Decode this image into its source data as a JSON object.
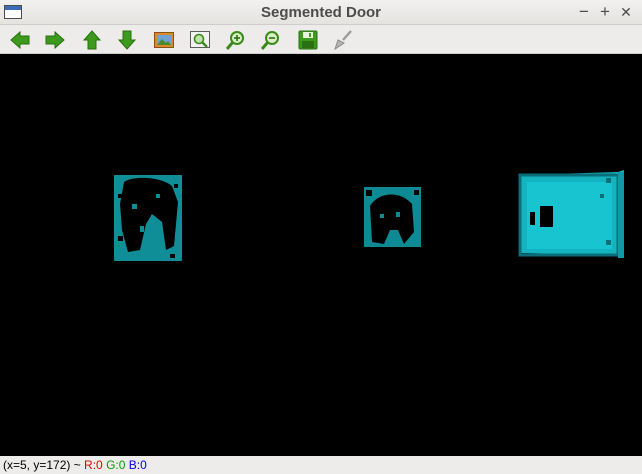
{
  "window": {
    "title": "Segmented Door"
  },
  "title_buttons": {
    "minimize": "−",
    "maximize": "+",
    "close": "✕"
  },
  "toolbar": {
    "items": [
      {
        "icon": "arrow-left-icon"
      },
      {
        "icon": "arrow-right-icon"
      },
      {
        "icon": "arrow-up-icon"
      },
      {
        "icon": "arrow-down-icon"
      },
      {
        "icon": "image-icon"
      },
      {
        "icon": "zoom-fit-icon"
      },
      {
        "icon": "zoom-in-icon"
      },
      {
        "icon": "zoom-out-icon"
      },
      {
        "icon": "save-icon"
      },
      {
        "icon": "brush-icon"
      }
    ]
  },
  "status": {
    "coords": "(x=5, y=172) ~ ",
    "r": "R:0",
    "g": "G:0",
    "b": "B:0"
  },
  "colors": {
    "segment": "#13b3c0",
    "background": "#000000"
  }
}
